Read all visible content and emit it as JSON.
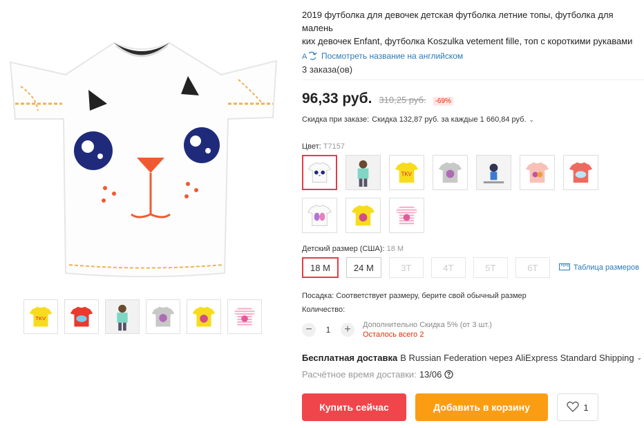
{
  "product": {
    "title": "2019 футболка для девочек детская футболка летние топы, футболка для малень\nких девочек Enfant, футболка Koszulka vetement fille, топ с короткими рукавами",
    "translate_link": "Посмотреть название на английском",
    "orders": "3 заказа(ов)",
    "price": "96,33 руб.",
    "old_price": "310,25 руб.",
    "discount": "-69%",
    "coupon_label": "Скидка при заказе:",
    "coupon_text": "Скидка 132,87 руб. за каждые 1 660,84 руб.",
    "coupon_chevron": "⌄"
  },
  "color": {
    "label": "Цвет:",
    "value": "T7157",
    "swatches": [
      {
        "name": "white-cat",
        "selected": true
      },
      {
        "name": "girl-photo",
        "selected": false
      },
      {
        "name": "yellow-tkv",
        "selected": false
      },
      {
        "name": "grey-print",
        "selected": false
      },
      {
        "name": "white-figure",
        "selected": false
      },
      {
        "name": "pink-print",
        "selected": false
      },
      {
        "name": "red-whale",
        "selected": false
      },
      {
        "name": "white-butterfly",
        "selected": false
      },
      {
        "name": "yellow-print",
        "selected": false
      },
      {
        "name": "pink-stripes",
        "selected": false
      }
    ]
  },
  "size": {
    "label": "Детский размер (США):",
    "value": "18 M",
    "options": [
      {
        "label": "18 M",
        "state": "selected"
      },
      {
        "label": "24 M",
        "state": "normal"
      },
      {
        "label": "3T",
        "state": "disabled"
      },
      {
        "label": "4T",
        "state": "disabled"
      },
      {
        "label": "5T",
        "state": "disabled"
      },
      {
        "label": "6T",
        "state": "disabled"
      }
    ],
    "table_link": "Таблица размеров"
  },
  "fit": "Посадка: Соответствует размеру, берите свой обычный размер",
  "quantity": {
    "label": "Количество:",
    "minus": "−",
    "value": "1",
    "plus": "+",
    "extra_discount": "Дополнительно Скидка 5% (от 3 шт.)",
    "stock_left": "Осталось всего 2"
  },
  "shipping": {
    "free": "Бесплатная доставка",
    "text": "В Russian Federation через AliExpress Standard Shipping",
    "chevron": "⌄",
    "eta_label": "Расчётное время доставки:",
    "eta_date": "13/06"
  },
  "actions": {
    "buy_now": "Купить сейчас",
    "add_to_cart": "Добавить в корзину",
    "wishlist_count": "1"
  },
  "thumbnails": [
    "yellow-tkv",
    "red-whale",
    "girl-photo",
    "grey-print",
    "yellow-print",
    "pink-stripes"
  ],
  "colors": {
    "accent_red": "#f0454a",
    "accent_orange": "#fb9d12",
    "link_blue": "#2a7ab8",
    "discount_red": "#e62e04"
  }
}
